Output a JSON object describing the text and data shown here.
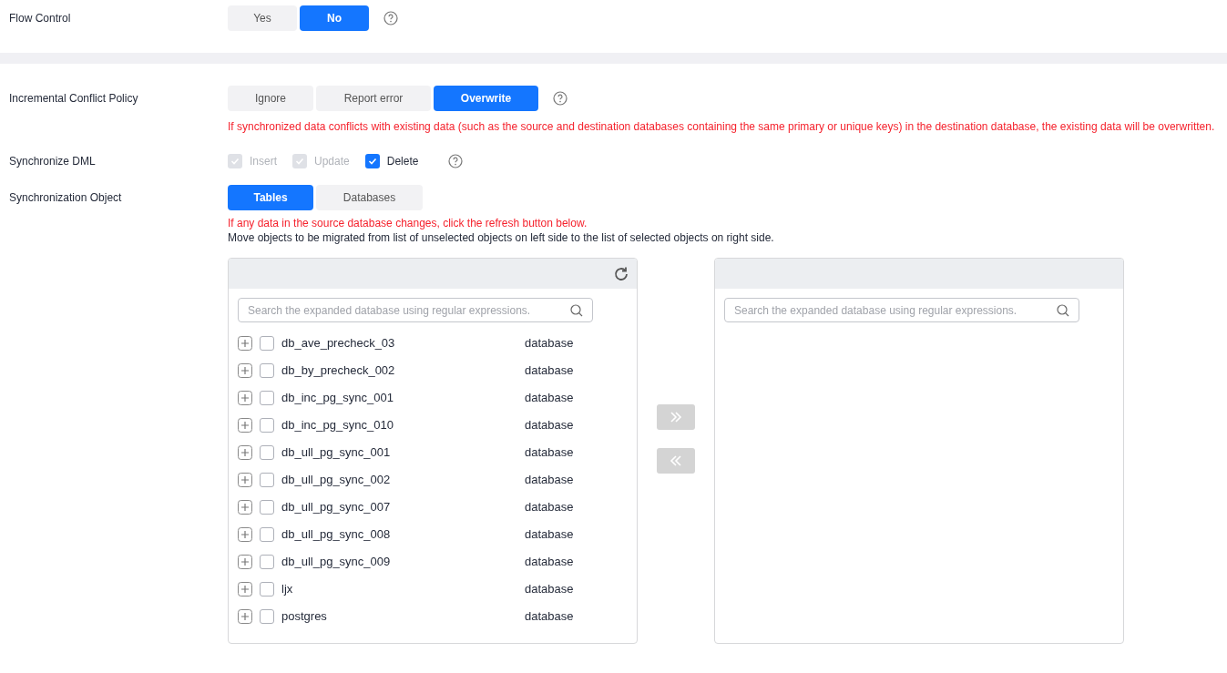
{
  "flow_control": {
    "label": "Flow Control",
    "options": [
      {
        "label": "Yes",
        "selected": false
      },
      {
        "label": "No",
        "selected": true
      }
    ]
  },
  "conflict_policy": {
    "label": "Incremental Conflict Policy",
    "options": [
      {
        "label": "Ignore",
        "selected": false
      },
      {
        "label": "Report error",
        "selected": false
      },
      {
        "label": "Overwrite",
        "selected": true
      }
    ],
    "warning": "If synchronized data conflicts with existing data (such as the source and destination databases containing the same primary or unique keys) in the destination database, the existing data will be overwritten."
  },
  "synchronize_dml": {
    "label": "Synchronize DML",
    "options": [
      {
        "label": "Insert",
        "checked": true,
        "disabled": true
      },
      {
        "label": "Update",
        "checked": true,
        "disabled": true
      },
      {
        "label": "Delete",
        "checked": true,
        "disabled": false
      }
    ]
  },
  "synchronization_object": {
    "label": "Synchronization Object",
    "options": [
      {
        "label": "Tables",
        "selected": true
      },
      {
        "label": "Databases",
        "selected": false
      }
    ],
    "warning": "If any data in the source database changes, click the refresh button below.",
    "note": "Move objects to be migrated from list of unselected objects on left side to the list of selected objects on right side."
  },
  "transfer": {
    "left": {
      "search_placeholder": "Search the expanded database using regular expressions.",
      "items": [
        {
          "name": "db_ave_precheck_03",
          "type": "database",
          "checked": false
        },
        {
          "name": "db_by_precheck_002",
          "type": "database",
          "checked": false
        },
        {
          "name": "db_inc_pg_sync_001",
          "type": "database",
          "checked": false
        },
        {
          "name": "db_inc_pg_sync_010",
          "type": "database",
          "checked": false
        },
        {
          "name": "db_ull_pg_sync_001",
          "type": "database",
          "checked": false
        },
        {
          "name": "db_ull_pg_sync_002",
          "type": "database",
          "checked": false
        },
        {
          "name": "db_ull_pg_sync_007",
          "type": "database",
          "checked": false
        },
        {
          "name": "db_ull_pg_sync_008",
          "type": "database",
          "checked": false
        },
        {
          "name": "db_ull_pg_sync_009",
          "type": "database",
          "checked": false
        },
        {
          "name": "ljx",
          "type": "database",
          "checked": false
        },
        {
          "name": "postgres",
          "type": "database",
          "checked": false
        }
      ]
    },
    "move_right": {
      "disabled": true
    },
    "move_left": {
      "disabled": true
    },
    "right": {
      "search_placeholder": "Search the expanded database using regular expressions."
    }
  }
}
